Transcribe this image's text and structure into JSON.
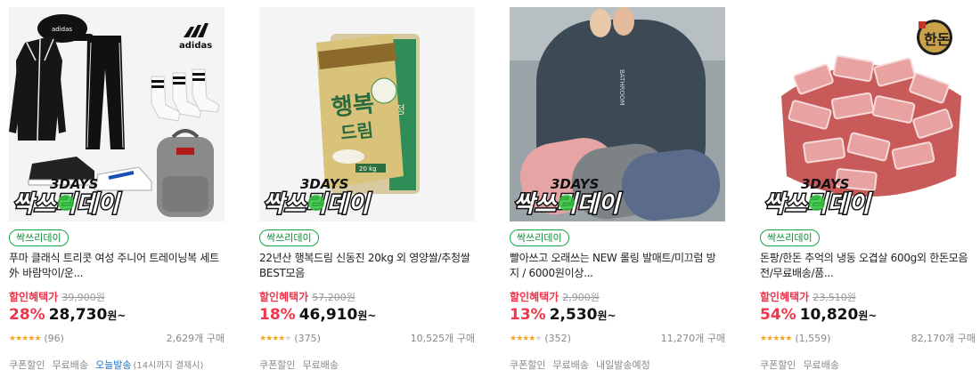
{
  "products": [
    {
      "badge_top": "3DAYS",
      "badge_main": "싹쓰리데이",
      "tag": "싹쓰리데이",
      "title": "푸마 클래식 트리콧 여성 주니어 트레이닝복 세트 外 바람막이/운...",
      "price_label": "할인혜택가",
      "original_price": "39,900원",
      "discount_rate": "28%",
      "price": "28,730",
      "price_unit": "원~",
      "rating": 4.5,
      "stars": "★★★★★",
      "reviews": "(96)",
      "purchases": "2,629개 구매",
      "shipping": [
        "쿠폰할인",
        "무료배송"
      ],
      "today_ship": "오늘발송",
      "today_note": "(14시까지 결제시)",
      "image_icons": [
        "adidas-logo-icon",
        "cap-icon",
        "tracksuit-icon",
        "socks-icon",
        "sneakers-icon",
        "backpack-icon"
      ]
    },
    {
      "badge_top": "3DAYS",
      "badge_main": "싹쓰리데이",
      "tag": "싹쓰리데이",
      "title": "22년산 행복드림 신동진 20kg 외 영양쌀/추청쌀 BEST모음",
      "price_label": "할인혜택가",
      "original_price": "57,200원",
      "discount_rate": "18%",
      "price": "46,910",
      "price_unit": "원~",
      "rating": 4,
      "stars": "★★★★★",
      "reviews": "(375)",
      "purchases": "10,525개 구매",
      "shipping": [
        "쿠폰할인",
        "무료배송"
      ],
      "image_text": "행복드림",
      "image_icons": [
        "rice-bag-icon"
      ]
    },
    {
      "badge_top": "3DAYS",
      "badge_main": "싹쓰리데이",
      "tag": "싹쓰리데이",
      "title": "빨아쓰고 오래쓰는 NEW 롤링 발매트/미끄럼 방지 / 6000원이상...",
      "price_label": "할인혜택가",
      "original_price": "2,900원",
      "discount_rate": "13%",
      "price": "2,530",
      "price_unit": "원~",
      "rating": 4,
      "stars": "★★★★★",
      "reviews": "(352)",
      "purchases": "11,270개 구매",
      "shipping": [
        "쿠폰할인",
        "무료배송",
        "내일발송예정"
      ],
      "image_text": "BATHROOM",
      "image_icons": [
        "bath-mat-icon",
        "feet-icon"
      ]
    },
    {
      "badge_top": "3DAYS",
      "badge_main": "싹쓰리데이",
      "tag": "싹쓰리데이",
      "title": "돈팡/한돈 추억의 냉동 오겹살 600g외 한돈모음전/무료배송/품...",
      "price_label": "할인혜택가",
      "original_price": "23,510원",
      "discount_rate": "54%",
      "price": "10,820",
      "price_unit": "원~",
      "rating": 5,
      "stars": "★★★★★",
      "reviews": "(1,559)",
      "purchases": "82,170개 구매",
      "shipping": [
        "쿠폰할인",
        "무료배송"
      ],
      "image_text": "한돈",
      "image_icons": [
        "pork-belly-icon",
        "handon-logo-icon"
      ]
    }
  ],
  "colors": {
    "discount": "#f0354b",
    "tag_green": "#11a440",
    "star": "#f5a623",
    "today_blue": "#1a73c9",
    "badge_green": "#2ec13b"
  }
}
